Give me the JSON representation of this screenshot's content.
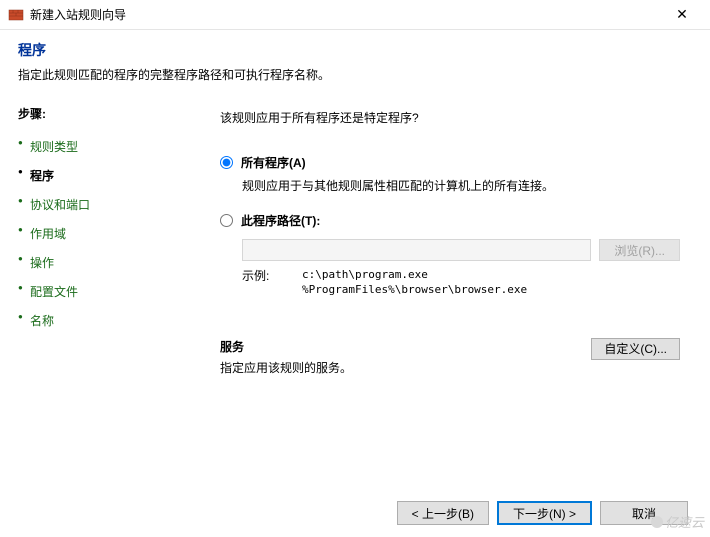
{
  "titlebar": {
    "title": "新建入站规则向导",
    "close": "✕"
  },
  "header": {
    "title": "程序",
    "subtitle": "指定此规则匹配的程序的完整程序路径和可执行程序名称。"
  },
  "sidebar": {
    "steps_label": "步骤:",
    "items": [
      {
        "label": "规则类型"
      },
      {
        "label": "程序"
      },
      {
        "label": "协议和端口"
      },
      {
        "label": "作用域"
      },
      {
        "label": "操作"
      },
      {
        "label": "配置文件"
      },
      {
        "label": "名称"
      }
    ],
    "current_index": 1
  },
  "content": {
    "question": "该规则应用于所有程序还是特定程序?",
    "radios": {
      "all": {
        "label": "所有程序(A)",
        "desc": "规则应用于与其他规则属性相匹配的计算机上的所有连接。"
      },
      "path": {
        "label": "此程序路径(T):",
        "browse": "浏览(R)...",
        "example_label": "示例:",
        "example_paths": "c:\\path\\program.exe\n%ProgramFiles%\\browser\\browser.exe"
      }
    },
    "service": {
      "title": "服务",
      "desc": "指定应用该规则的服务。",
      "customize": "自定义(C)..."
    }
  },
  "footer": {
    "back": "< 上一步(B)",
    "next": "下一步(N) >",
    "cancel": "取消"
  },
  "watermark": "亿速云"
}
